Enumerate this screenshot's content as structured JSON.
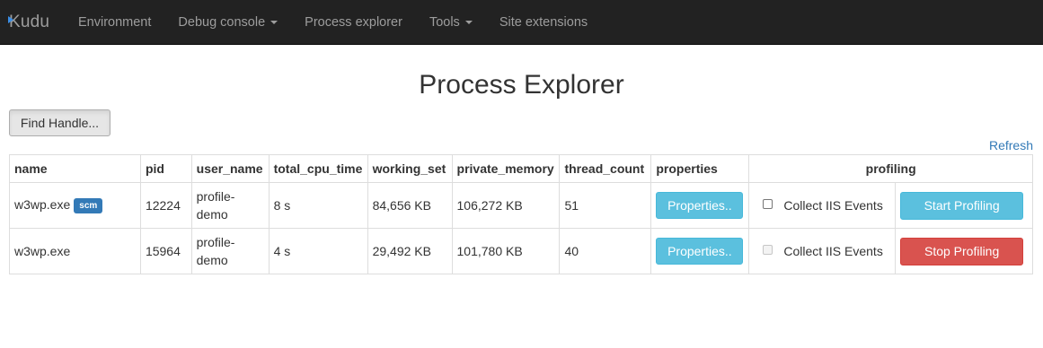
{
  "nav": {
    "brand": "Kudu",
    "items": [
      {
        "label": "Environment",
        "dropdown": false
      },
      {
        "label": "Debug console",
        "dropdown": true
      },
      {
        "label": "Process explorer",
        "dropdown": false
      },
      {
        "label": "Tools",
        "dropdown": true
      },
      {
        "label": "Site extensions",
        "dropdown": false
      }
    ]
  },
  "page": {
    "title": "Process Explorer",
    "find_handle_label": "Find Handle...",
    "refresh_label": "Refresh"
  },
  "table": {
    "headers": [
      "name",
      "pid",
      "user_name",
      "total_cpu_time",
      "working_set",
      "private_memory",
      "thread_count",
      "properties",
      "profiling"
    ],
    "rows": [
      {
        "name": "w3wp.exe",
        "badge": "scm",
        "pid": "12224",
        "user_name": "profile-demo",
        "total_cpu_time": "8 s",
        "working_set": "84,656 KB",
        "private_memory": "106,272 KB",
        "thread_count": "51",
        "properties_label": "Properties..",
        "collect_label": "Collect IIS Events",
        "collect_disabled": false,
        "profile_label": "Start Profiling"
      },
      {
        "name": "w3wp.exe",
        "badge": "",
        "pid": "15964",
        "user_name": "profile-demo",
        "total_cpu_time": "4 s",
        "working_set": "29,492 KB",
        "private_memory": "101,780 KB",
        "thread_count": "40",
        "properties_label": "Properties..",
        "collect_label": "Collect IIS Events",
        "collect_disabled": true,
        "profile_label": "Stop Profiling"
      }
    ]
  },
  "colors": {
    "navbar_bg": "#222222",
    "link": "#337ab7",
    "info": "#5bc0de",
    "danger": "#d9534f"
  }
}
